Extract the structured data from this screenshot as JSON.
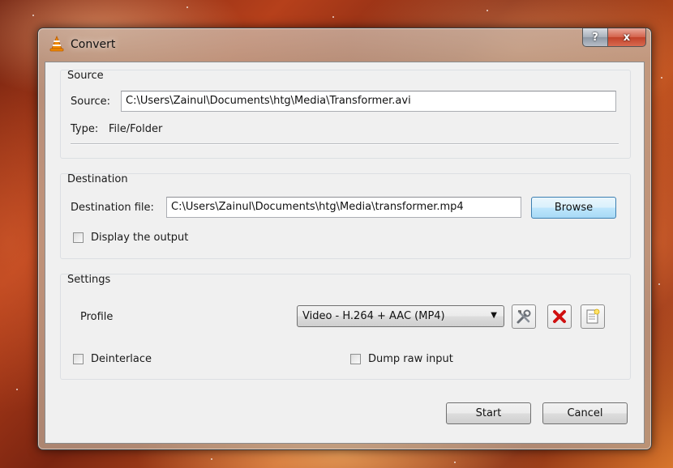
{
  "window": {
    "title": "Convert"
  },
  "caption": {
    "help": "?",
    "close": "x"
  },
  "source": {
    "group_title": "Source",
    "source_label": "Source:",
    "source_value": "C:\\Users\\Zainul\\Documents\\htg\\Media\\Transformer.avi",
    "type_label": "Type:",
    "type_value": "File/Folder"
  },
  "destination": {
    "group_title": "Destination",
    "file_label": "Destination file:",
    "file_value": "C:\\Users\\Zainul\\Documents\\htg\\Media\\transformer.mp4",
    "browse_label": "Browse",
    "display_output_label": "Display the output",
    "display_output_checked": false
  },
  "settings": {
    "group_title": "Settings",
    "profile_label": "Profile",
    "profile_value": "Video - H.264 + AAC (MP4)",
    "deinterlace_label": "Deinterlace",
    "deinterlace_checked": false,
    "dump_raw_label": "Dump raw input",
    "dump_raw_checked": false,
    "tools": [
      "edit-profile-icon",
      "delete-profile-icon",
      "new-profile-icon"
    ]
  },
  "actions": {
    "start_label": "Start",
    "cancel_label": "Cancel"
  },
  "colors": {
    "delete_red": "#d01010",
    "focus_blue": "#3c7fb1",
    "vlc_orange": "#f08a00"
  }
}
